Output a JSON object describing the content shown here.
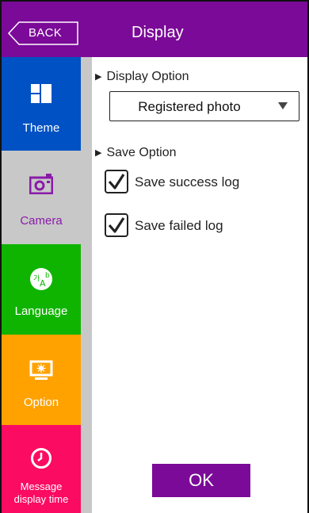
{
  "header": {
    "back_label": "BACK",
    "title": "Display"
  },
  "sidebar": {
    "items": [
      {
        "label": "Theme",
        "icon": "theme-icon",
        "color": "#0051c4"
      },
      {
        "label": "Camera",
        "icon": "camera-icon",
        "color": "#c8c8c8",
        "selected": true
      },
      {
        "label": "Language",
        "icon": "language-icon",
        "color": "#0fb400"
      },
      {
        "label": "Option",
        "icon": "monitor-icon",
        "color": "#ffa200"
      },
      {
        "label": "Message\ndisplay time",
        "icon": "clock-icon",
        "color": "#fb0b62"
      }
    ]
  },
  "content": {
    "display_option": {
      "label": "Display Option",
      "selected_value": "Registered photo"
    },
    "save_option": {
      "label": "Save Option",
      "success_log": {
        "label": "Save success log",
        "checked": true
      },
      "failed_log": {
        "label": "Save failed log",
        "checked": true
      }
    }
  },
  "footer": {
    "ok_label": "OK"
  },
  "colors": {
    "accent": "#7b0a98"
  }
}
